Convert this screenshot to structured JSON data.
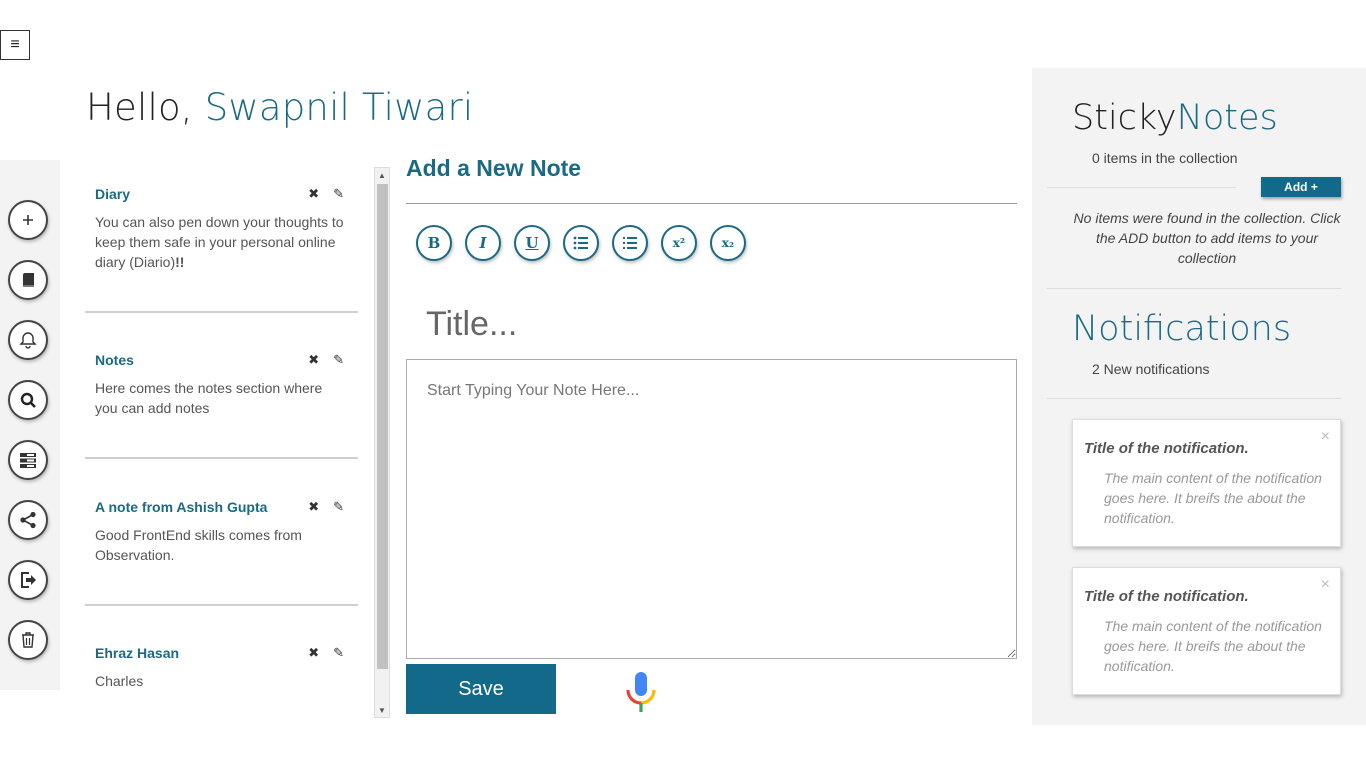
{
  "menu_toggle": {
    "label": "≡"
  },
  "greeting": {
    "prefix": "Hello, ",
    "name": "Swapnil Tiwari"
  },
  "icon_rail": [
    {
      "name": "add",
      "icon": "plus-icon"
    },
    {
      "name": "diary",
      "icon": "book-icon"
    },
    {
      "name": "reminders",
      "icon": "bell-icon"
    },
    {
      "name": "search",
      "icon": "search-icon"
    },
    {
      "name": "list",
      "icon": "list-icon"
    },
    {
      "name": "share",
      "icon": "share-icon"
    },
    {
      "name": "logout",
      "icon": "sign-out-icon"
    },
    {
      "name": "trash",
      "icon": "trash-icon"
    }
  ],
  "notes": [
    {
      "title": "Diary",
      "body_parts": [
        "You can also pen down your thoughts to keep them safe in your personal online diary (Diario)",
        "!!"
      ]
    },
    {
      "title": "Notes",
      "body": "Here comes the notes section where you can add notes"
    },
    {
      "title": "A note from Ashish Gupta",
      "body": "Good FrontEnd skills comes from Observation."
    },
    {
      "title": "Ehraz Hasan",
      "body": "Charles"
    }
  ],
  "note_actions": {
    "delete_glyph": "✖",
    "edit_glyph": "✎"
  },
  "editor": {
    "heading": "Add a New Note",
    "toolbar": [
      {
        "name": "bold",
        "label": "B"
      },
      {
        "name": "italic",
        "label": "I"
      },
      {
        "name": "underline",
        "label": "U"
      },
      {
        "name": "bullet-list",
        "icon": "bullet-list-icon"
      },
      {
        "name": "numbered-list",
        "icon": "numbered-list-icon"
      },
      {
        "name": "superscript",
        "label": "x²"
      },
      {
        "name": "subscript",
        "label": "x₂"
      }
    ],
    "title_placeholder": "Title...",
    "body_placeholder": "Start Typing Your Note Here...",
    "save_label": "Save"
  },
  "sticky": {
    "heading_a": "Sticky",
    "heading_b": "Notes",
    "count": "0 items in the collection",
    "add_label": "Add +",
    "empty_message": "No items were found in the collection. Click the ADD button to add items to your collection"
  },
  "notifications": {
    "heading": "Notifications",
    "count": "2 New notifications",
    "items": [
      {
        "title": "Title of the notification.",
        "body": "The main content of the notification goes here. It breifs the about the notification."
      },
      {
        "title": "Title of the notification.",
        "body": "The main content of the notification goes here. It breifs the about the notification."
      }
    ],
    "close_glyph": "×"
  },
  "colors": {
    "accent": "#1a6a86",
    "button": "#13698a",
    "panel_bg": "#f3f3f3"
  }
}
